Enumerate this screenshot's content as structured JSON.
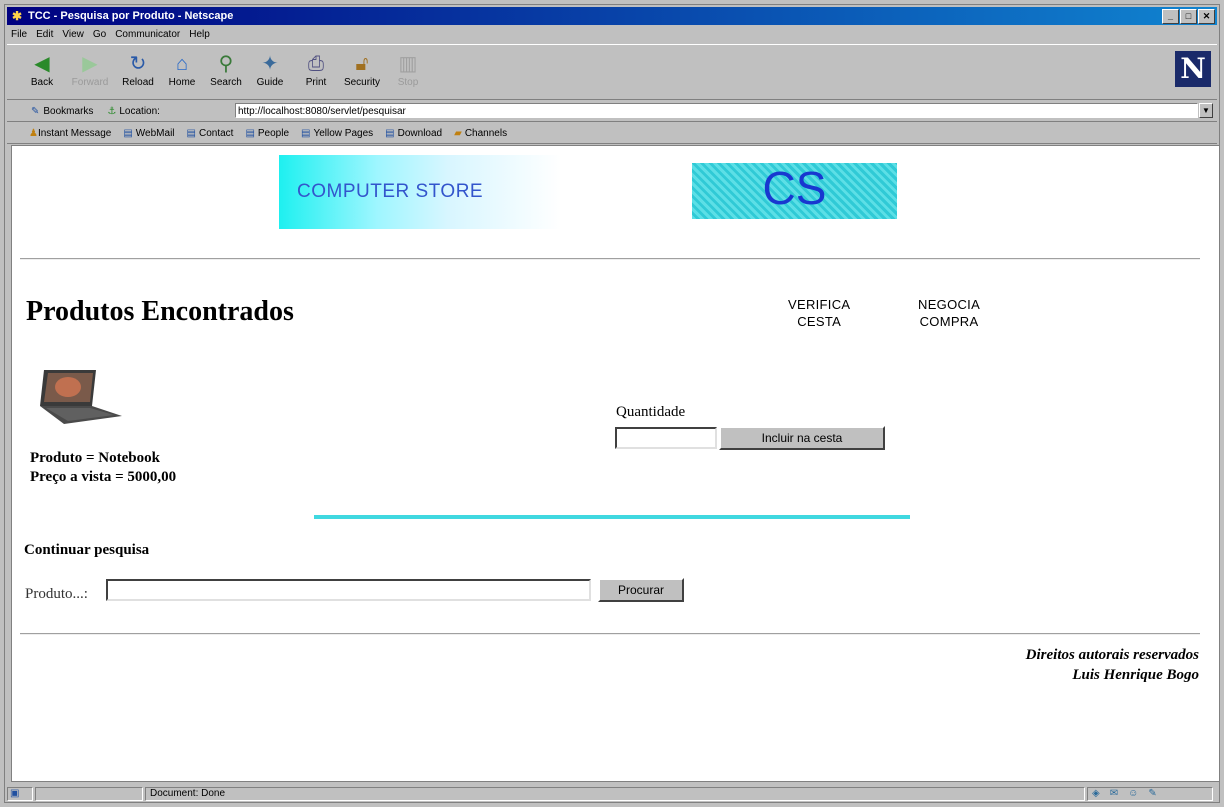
{
  "window": {
    "title": "TCC - Pesquisa por Produto - Netscape",
    "controls": {
      "minimize": "_",
      "maximize": "□",
      "close": "✕"
    }
  },
  "menu": [
    "File",
    "Edit",
    "View",
    "Go",
    "Communicator",
    "Help"
  ],
  "toolbar": {
    "back": "Back",
    "forward": "Forward",
    "reload": "Reload",
    "home": "Home",
    "search": "Search",
    "guide": "Guide",
    "print": "Print",
    "security": "Security",
    "stop": "Stop",
    "logo": "N"
  },
  "location": {
    "bookmarks_label": "Bookmarks",
    "location_label": "Location:",
    "url": "http://localhost:8080/servlet/pesquisar"
  },
  "personal_toolbar": [
    "Instant Message",
    "WebMail",
    "Contact",
    "People",
    "Yellow Pages",
    "Download",
    "Channels"
  ],
  "page": {
    "banner_text": "COMPUTER STORE",
    "logo_text": "CS",
    "heading": "Produtos Encontrados",
    "nav": {
      "verifica_line1": "Verifica",
      "verifica_line2": "Cesta",
      "negocia_line1": "Negocia",
      "negocia_line2": "Compra"
    },
    "product": {
      "name_line": "Produto = Notebook",
      "price_line": "Preço a vista = 5000,00"
    },
    "quantity": {
      "label": "Quantidade",
      "value": "",
      "add_button": "Incluir na cesta"
    },
    "search": {
      "heading": "Continuar pesquisa",
      "label": "Produto...:",
      "value": "",
      "button": "Procurar"
    },
    "footer": {
      "line1": "Direitos autorais reservados",
      "line2": "Luis Henrique Bogo"
    }
  },
  "status": {
    "text": "Document: Done"
  }
}
